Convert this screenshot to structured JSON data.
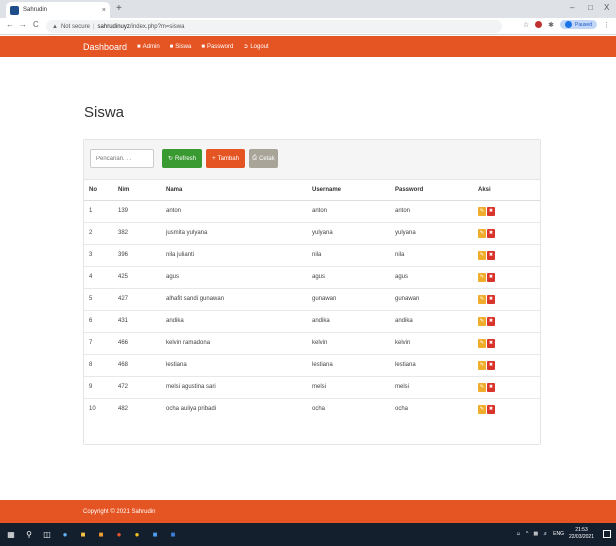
{
  "browser": {
    "tab_title": "Sahrudin",
    "tab_close": "×",
    "new_tab": "+",
    "win_minimize": "–",
    "win_maximize": "□",
    "win_close": "X",
    "back": "←",
    "forward": "→",
    "reload": "C",
    "security_label": "Not secure",
    "url_host": "sahrudinuyz",
    "url_path": "/index.php?m=siswa",
    "profile_label": "Paused",
    "profile_initial": "S",
    "menu": "⋮"
  },
  "navbar": {
    "brand": "Dashboard",
    "items": [
      {
        "label": "Admin",
        "icon": "user-icon"
      },
      {
        "label": "Siswa",
        "icon": "user-icon"
      },
      {
        "label": "Password",
        "icon": "user-icon"
      },
      {
        "label": "Logout",
        "icon": "logout-icon"
      }
    ],
    "color": "#e55523"
  },
  "page": {
    "title": "Siswa",
    "search_placeholder": "Pencarian. . .",
    "buttons": {
      "refresh": "Refresh",
      "tambah": "Tambah",
      "cetak": "Cetak"
    }
  },
  "table": {
    "headers": [
      "No",
      "Nim",
      "Nama",
      "Username",
      "Password",
      "Aksi"
    ],
    "rows": [
      {
        "no": "1",
        "nim": "139",
        "nama": "anton",
        "username": "anton",
        "password": "anton"
      },
      {
        "no": "2",
        "nim": "382",
        "nama": "jusmita yulyana",
        "username": "yulyana",
        "password": "yulyana"
      },
      {
        "no": "3",
        "nim": "396",
        "nama": "nila julianti",
        "username": "nila",
        "password": "nila"
      },
      {
        "no": "4",
        "nim": "425",
        "nama": "agus",
        "username": "agus",
        "password": "agus"
      },
      {
        "no": "5",
        "nim": "427",
        "nama": "alhafit sandi gunawan",
        "username": "gunawan",
        "password": "gunawan"
      },
      {
        "no": "6",
        "nim": "431",
        "nama": "andika",
        "username": "andika",
        "password": "andika"
      },
      {
        "no": "7",
        "nim": "466",
        "nama": "kelvin ramadona",
        "username": "kelvin",
        "password": "kelvin"
      },
      {
        "no": "8",
        "nim": "468",
        "nama": "lestiana",
        "username": "lestiana",
        "password": "lestiana"
      },
      {
        "no": "9",
        "nim": "472",
        "nama": "melsi agustina sari",
        "username": "melsi",
        "password": "melsi"
      },
      {
        "no": "10",
        "nim": "482",
        "nama": "ocha auliya pribadi",
        "username": "ocha",
        "password": "ocha"
      }
    ]
  },
  "footer": {
    "copyright": "Copyright © 2021 Sahrudin"
  },
  "taskbar": {
    "language": "ENG",
    "time": "21:53",
    "date": "22/03/2021"
  }
}
